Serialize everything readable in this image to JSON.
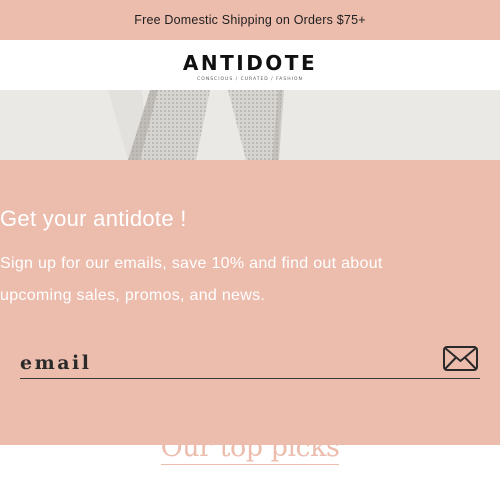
{
  "announcement": {
    "text": "Free Domestic Shipping on Orders $75+"
  },
  "brand": {
    "name": "ANTIDOTE",
    "tagline": "CONSCIOUS / CURATED / FASHION"
  },
  "popup": {
    "title": "Get your antidote !",
    "description": "Sign up for our emails, save 10% and find out about upcoming sales, promos, and news.",
    "email_placeholder": "email",
    "submit_icon": "envelope-icon"
  },
  "section": {
    "heading": "Our top picks"
  },
  "colors": {
    "accent": "#ecbcad",
    "text_dark": "#1f1f1f",
    "white": "#ffffff"
  }
}
